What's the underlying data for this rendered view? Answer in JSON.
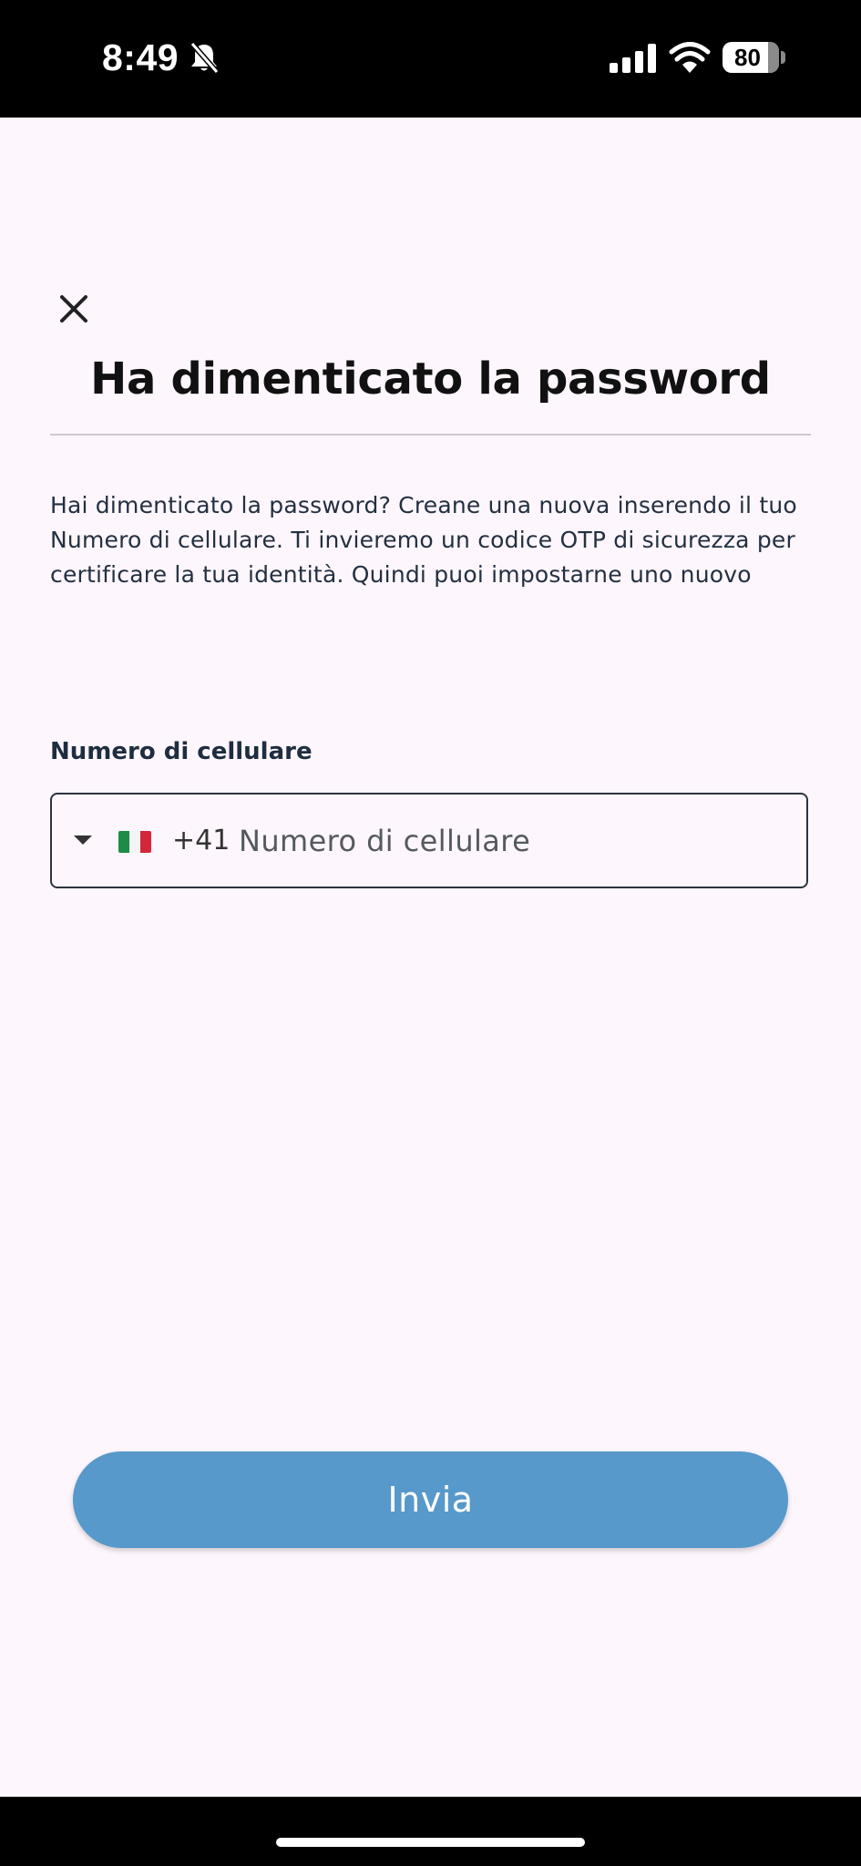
{
  "status_bar": {
    "time": "8:49",
    "battery_level": 80,
    "battery_label": "80",
    "icons": [
      "bell-slash-icon",
      "cellular-signal-icon",
      "wifi-icon",
      "battery-icon"
    ]
  },
  "header": {
    "close_icon": "close-icon",
    "title": "Ha dimenticato la password"
  },
  "body": {
    "description": "Hai dimenticato la password? Creane una nuova inserendo il tuo Numero di cellulare. Ti invieremo un codice OTP di sicurezza per certificare la tua identità. Quindi puoi impostarne uno nuovo"
  },
  "phone": {
    "label": "Numero di cellulare",
    "country_flag": "italy-flag-icon",
    "dial_code": "+41",
    "value": "",
    "placeholder": "Numero di cellulare"
  },
  "actions": {
    "submit_label": "Invia"
  },
  "colors": {
    "background": "#fdf6fc",
    "primary_button": "#5799cb",
    "text_dark": "#111111",
    "text_body": "#233042"
  }
}
